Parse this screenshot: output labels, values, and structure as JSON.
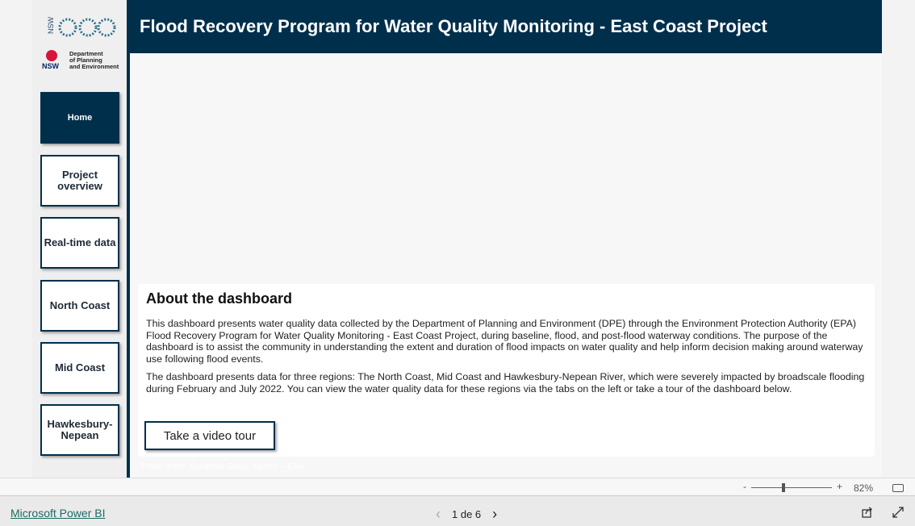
{
  "logos": {
    "epa": "nsw epa",
    "dpe": "NSW Department of Planning and Environment",
    "dpe_text": [
      "Department",
      "of Planning",
      "and Environment"
    ]
  },
  "header": {
    "title": "Flood Recovery Program for Water Quality Monitoring - East Coast Project"
  },
  "nav": [
    {
      "label": "Home",
      "active": true
    },
    {
      "label": "Project overview"
    },
    {
      "label": "Real-time data"
    },
    {
      "label": "North Coast"
    },
    {
      "label": "Mid Coast"
    },
    {
      "label": "Hawkesbury-Nepean"
    }
  ],
  "about": {
    "title": "About the dashboard",
    "p1": "This dashboard presents water quality data collected by the Department of Planning and Environment (DPE) through the Environment Protection Authority (EPA) Flood Recovery Program for Water Quality Monitoring - East Coast Project, during baseline, flood, and post-flood waterway conditions. The purpose of the dashboard is to assist the community in understanding the extent and duration of flood impacts on water quality and help inform decision making around waterway use following flood events.",
    "p2": "The dashboard presents data for three regions: The North Coast, Mid Coast and Hawkesbury-Nepean River, which were severely impacted by broadscale flooding during February and July 2022. You can view the water quality data for these regions via the tabs on the left or take a tour of the dashboard below.",
    "button": "Take a video tour"
  },
  "credit": "Photo credit: European Space Agency – ESA",
  "zoom": {
    "minus": "-",
    "plus": "+",
    "level": "82%",
    "value_percent": 82
  },
  "footer": {
    "brand": "Microsoft Power BI",
    "page": "1 de 6",
    "prev": "‹",
    "next": "›"
  },
  "colors": {
    "navy": "#002f4c",
    "link": "#1a6b62"
  }
}
